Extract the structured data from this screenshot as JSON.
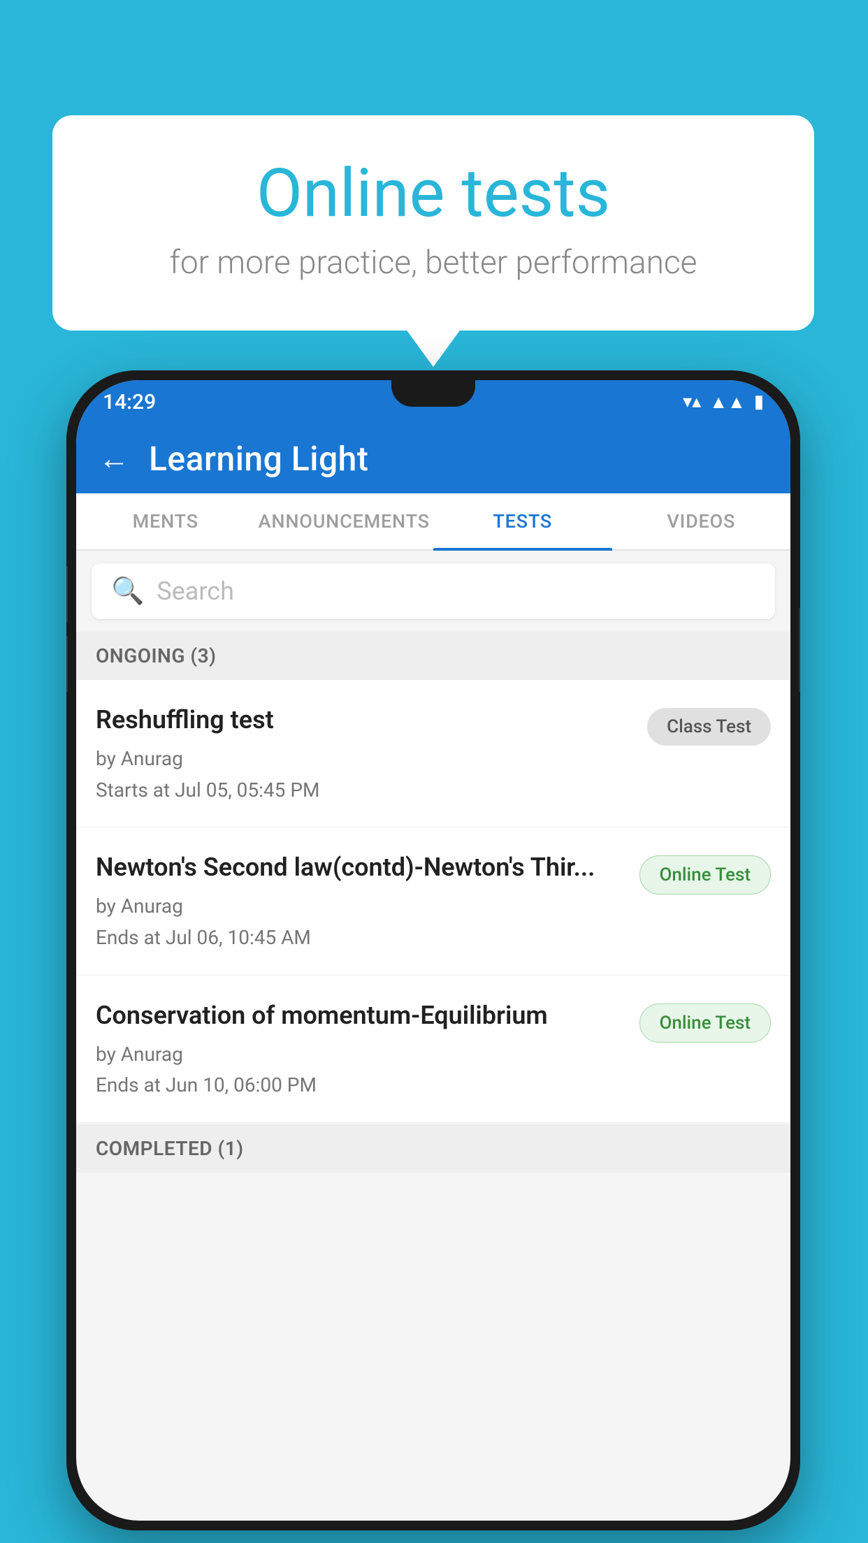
{
  "background_color": "#29b6d8",
  "bubble": {
    "title": "Online tests",
    "subtitle": "for more practice, better performance"
  },
  "phone": {
    "status_bar": {
      "time": "14:29",
      "icons": [
        "wifi",
        "signal",
        "battery"
      ]
    },
    "app_bar": {
      "back_label": "←",
      "title": "Learning Light"
    },
    "tabs": [
      {
        "label": "MENTS",
        "active": false
      },
      {
        "label": "ANNOUNCEMENTS",
        "active": false
      },
      {
        "label": "TESTS",
        "active": true
      },
      {
        "label": "VIDEOS",
        "active": false
      }
    ],
    "search": {
      "placeholder": "Search"
    },
    "ongoing_section": {
      "label": "ONGOING (3)"
    },
    "tests": [
      {
        "title": "Reshuffling test",
        "by": "by Anurag",
        "date": "Starts at  Jul 05, 05:45 PM",
        "badge": "Class Test",
        "badge_type": "class"
      },
      {
        "title": "Newton's Second law(contd)-Newton's Thir...",
        "by": "by Anurag",
        "date": "Ends at  Jul 06, 10:45 AM",
        "badge": "Online Test",
        "badge_type": "online"
      },
      {
        "title": "Conservation of momentum-Equilibrium",
        "by": "by Anurag",
        "date": "Ends at  Jun 10, 06:00 PM",
        "badge": "Online Test",
        "badge_type": "online"
      }
    ],
    "completed_section": {
      "label": "COMPLETED (1)"
    }
  }
}
